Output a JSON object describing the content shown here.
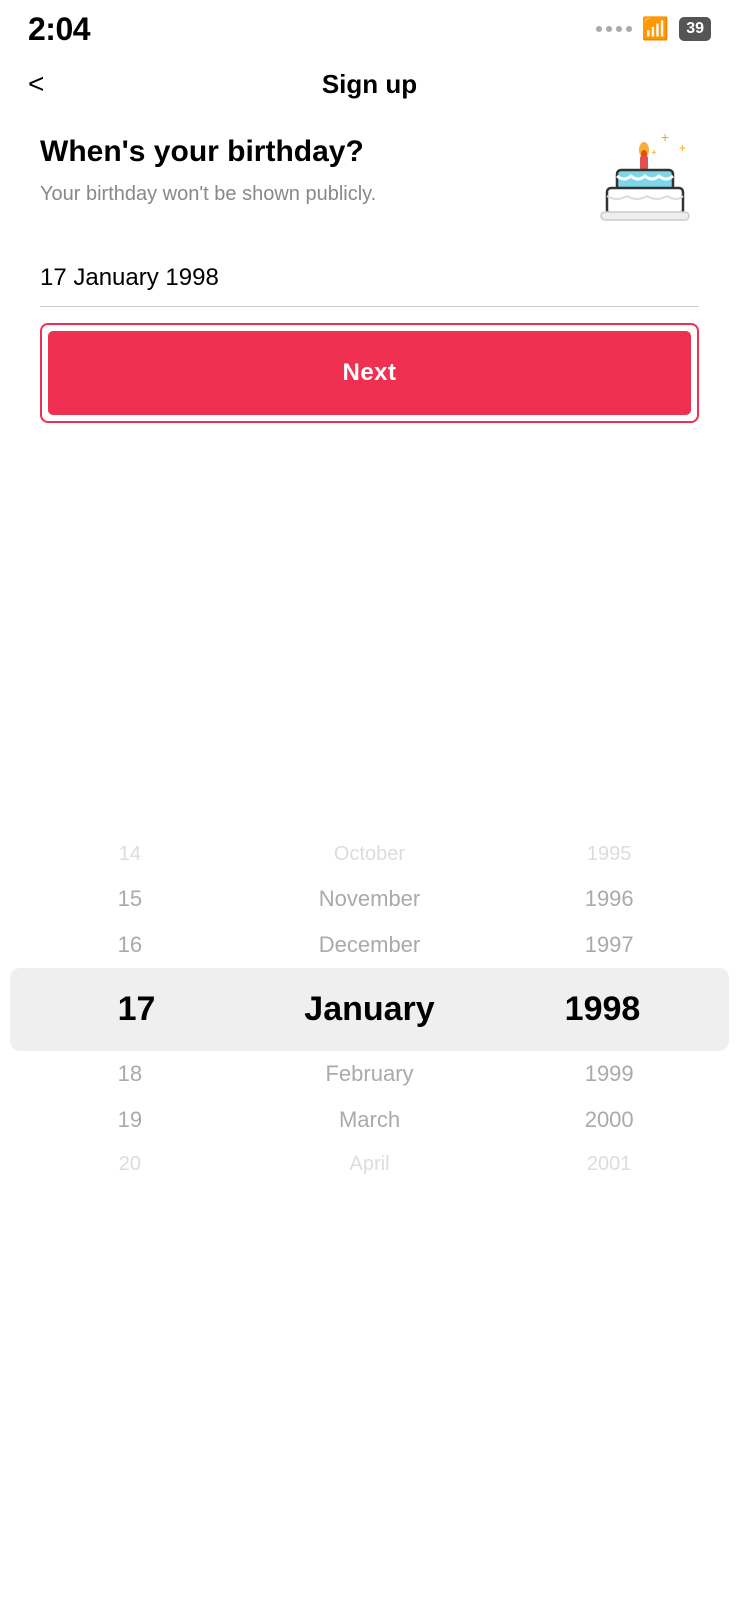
{
  "status_bar": {
    "time": "2:04",
    "battery": "39"
  },
  "nav": {
    "back_label": "<",
    "title": "Sign up"
  },
  "birthday_section": {
    "title": "When's your birthday?",
    "subtitle": "Your birthday won't be shown publicly.",
    "selected_date": "17 January 1998"
  },
  "next_button": {
    "label": "Next"
  },
  "picker": {
    "rows": [
      {
        "day": "14",
        "month": "October",
        "year": "1995",
        "state": "faded"
      },
      {
        "day": "15",
        "month": "November",
        "year": "1996",
        "state": "dim"
      },
      {
        "day": "16",
        "month": "December",
        "year": "1997",
        "state": "dim"
      },
      {
        "day": "17",
        "month": "January",
        "year": "1998",
        "state": "selected"
      },
      {
        "day": "18",
        "month": "February",
        "year": "1999",
        "state": "dim"
      },
      {
        "day": "19",
        "month": "March",
        "year": "2000",
        "state": "dim"
      },
      {
        "day": "20",
        "month": "April",
        "year": "2001",
        "state": "faded"
      }
    ]
  }
}
